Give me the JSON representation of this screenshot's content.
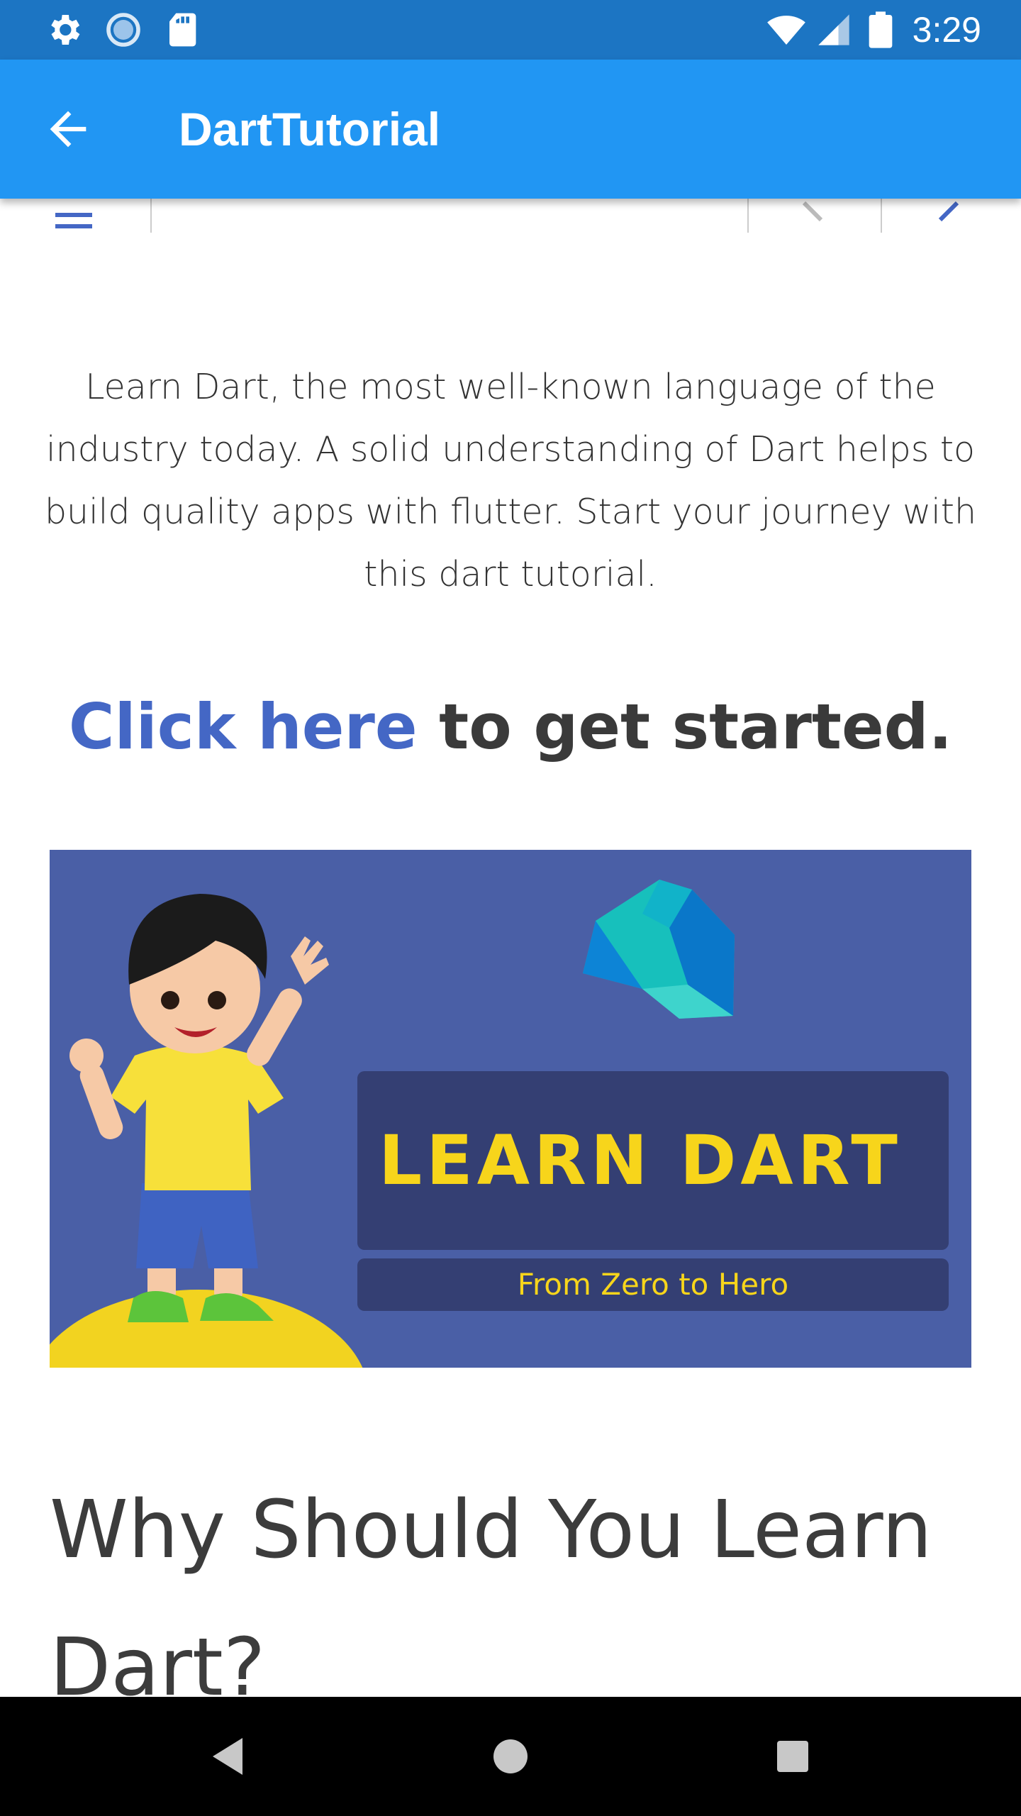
{
  "status_bar": {
    "time": "3:29",
    "icons": [
      "settings-icon",
      "sync-icon",
      "sd-card-icon",
      "wifi-icon",
      "cell-signal-icon",
      "battery-icon"
    ]
  },
  "app_bar": {
    "title": "DartTutorial",
    "back_icon": "arrow-back-icon",
    "color": "#2196f3"
  },
  "page": {
    "nav_icons": [
      "menu-icon",
      "chevron-left-icon",
      "chevron-right-icon"
    ],
    "intro": "Learn Dart, the most well-known language of the industry today. A solid understanding of Dart helps to build quality apps with flutter. Start your journey with this dart tutorial.",
    "cta_link": "Click here",
    "cta_rest": " to get started.",
    "link_color": "#4467c5",
    "banner": {
      "title": "LEARN DART",
      "subtitle": "From Zero to Hero",
      "background": "#4a5fa6",
      "text_color": "#f7d51b"
    },
    "heading": "Why Should You Learn Dart?"
  },
  "nav_bar": {
    "buttons": [
      "back-triangle-icon",
      "home-circle-icon",
      "recents-square-icon"
    ]
  }
}
